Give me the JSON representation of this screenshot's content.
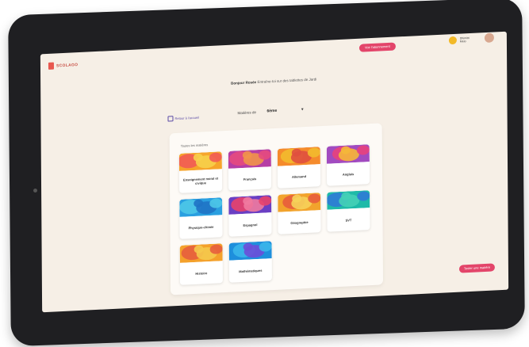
{
  "app": {
    "logo_text": "SCOLAGO"
  },
  "topbar": {
    "cta_label": "Voir l'abonnement",
    "user": {
      "name": "Dhimitri\nMélo"
    }
  },
  "greeting": {
    "name": "Bonjour Rosée",
    "message": "Entraîne-toi sur des tablettes de Jardi"
  },
  "back_link": "Retour à l'accueil",
  "level": {
    "label": "Matières de",
    "value": "6ème"
  },
  "panel_heading": "Toutes les matières",
  "subjects": [
    {
      "label": "Enseignement moral et civique",
      "colors": [
        "#f6a52b",
        "#f25c54",
        "#f7d04a"
      ]
    },
    {
      "label": "Français",
      "colors": [
        "#b63ea5",
        "#e54a7f",
        "#f1944a"
      ]
    },
    {
      "label": "Allemand",
      "colors": [
        "#f58b2c",
        "#f3ba2d",
        "#e04f3f"
      ]
    },
    {
      "label": "Anglais",
      "colors": [
        "#a14bc0",
        "#e7427d",
        "#f4b73a"
      ]
    },
    {
      "label": "Physique-chimie",
      "colors": [
        "#2a9fe0",
        "#4cc6e8",
        "#1f73c5"
      ]
    },
    {
      "label": "Espagnol",
      "colors": [
        "#6a3fc3",
        "#e8436b",
        "#f07aa0"
      ]
    },
    {
      "label": "Géographie",
      "colors": [
        "#f2a32c",
        "#e85d3c",
        "#f6d15a"
      ]
    },
    {
      "label": "SVT",
      "colors": [
        "#1ebaa8",
        "#2f7bd5",
        "#44d0b6"
      ]
    },
    {
      "label": "Histoire",
      "colors": [
        "#f4a12b",
        "#e75e3d",
        "#f5c94c"
      ]
    },
    {
      "label": "Mathématiques",
      "colors": [
        "#1e8fdc",
        "#3ab6ea",
        "#6b4ed8"
      ]
    }
  ],
  "bottom_cta": "Tester une matière",
  "colors": {
    "accent": "#e3456a",
    "screen_bg": "#f6efe6",
    "bezel": "#1f1f22"
  }
}
